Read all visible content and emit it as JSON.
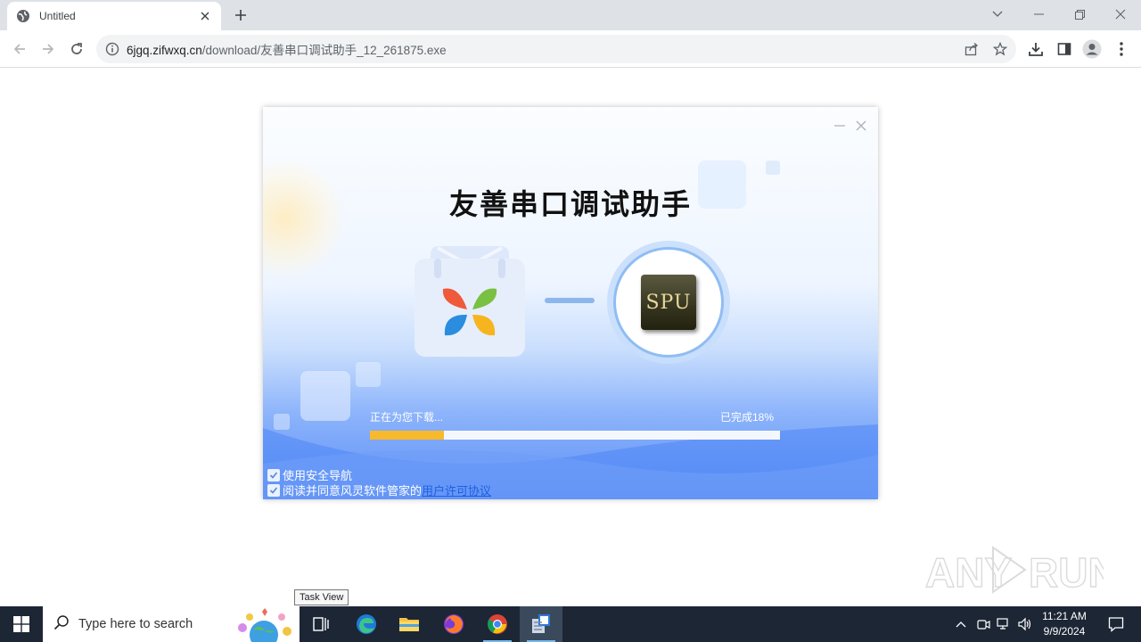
{
  "browser": {
    "tab_title": "Untitled",
    "url_host": "6jgq.zifwxq.cn",
    "url_path": "/download/友善串口调试助手_12_261875.exe"
  },
  "installer": {
    "title": "友善串口调试助手",
    "app_icon_text": "SPU",
    "status_text": "正在为您下载...",
    "percent_text": "已完成18%",
    "progress": 0.18,
    "option_nav": "使用安全导航",
    "option_agree": "阅读并同意风灵软件管家的",
    "agreement_link": "用户许可协议"
  },
  "tooltip": "Task View",
  "taskbar": {
    "search_placeholder": "Type here to search",
    "time": "11:21 AM",
    "date": "9/9/2024"
  },
  "watermark": "ANY RUN",
  "colors": {
    "progress_fill": "#f9b92c",
    "taskbar_bg": "#1c2635",
    "link": "#1f5fe0"
  }
}
